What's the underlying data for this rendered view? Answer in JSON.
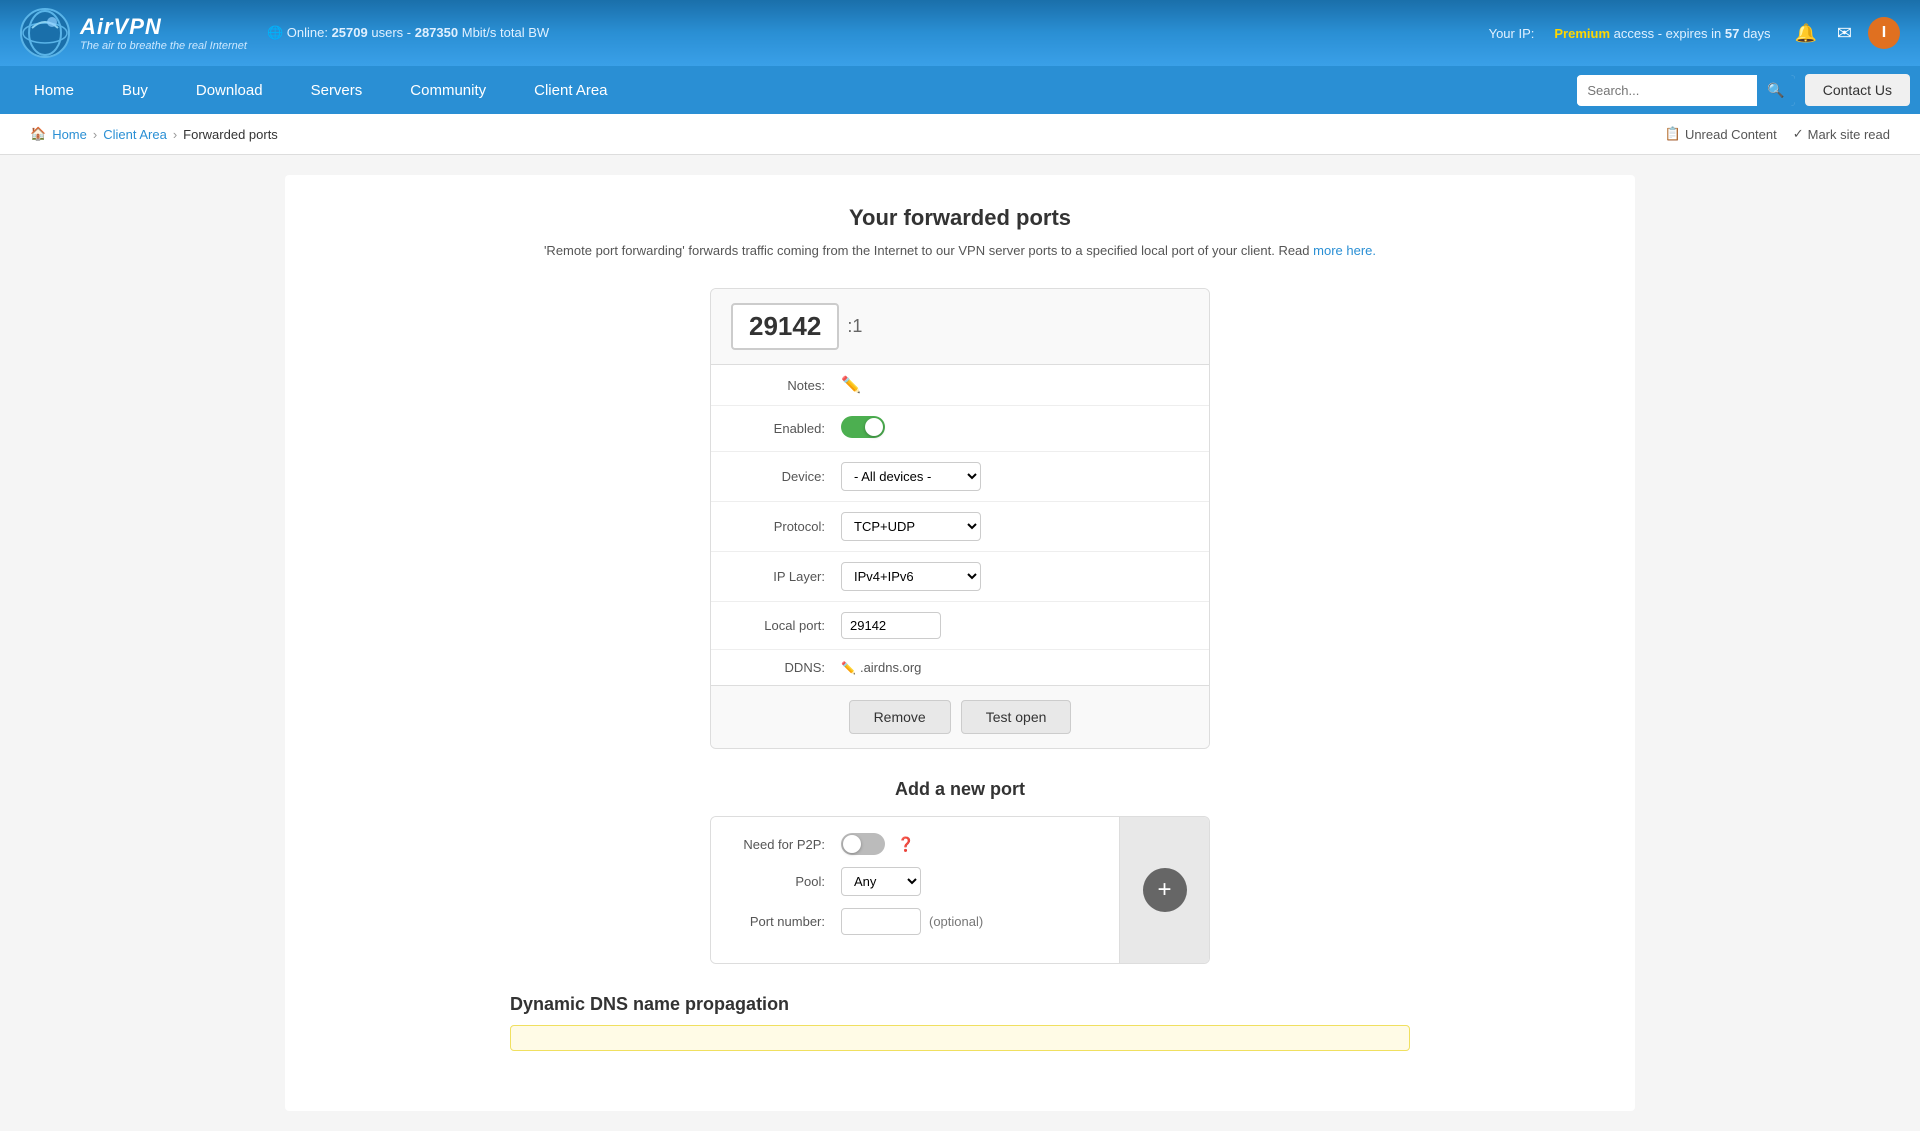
{
  "header": {
    "logo_title": "AirVPN",
    "logo_subtitle": "The air to breathe the real Internet",
    "stats_online_label": "Online:",
    "stats_users": "25709",
    "stats_users_suffix": "users -",
    "stats_bandwidth": "287350",
    "stats_bandwidth_suffix": "Mbit/s total BW",
    "ip_label": "Your IP:",
    "premium_label": "Premium",
    "premium_suffix": "access - expires in",
    "premium_days": "57",
    "premium_days_suffix": "days",
    "user_initial": "I"
  },
  "nav": {
    "links": [
      {
        "label": "Home",
        "key": "home"
      },
      {
        "label": "Buy",
        "key": "buy"
      },
      {
        "label": "Download",
        "key": "download"
      },
      {
        "label": "Servers",
        "key": "servers"
      },
      {
        "label": "Community",
        "key": "community"
      },
      {
        "label": "Client Area",
        "key": "client-area"
      }
    ],
    "search_placeholder": "Search...",
    "contact_label": "Contact Us"
  },
  "breadcrumb": {
    "home": "Home",
    "client_area": "Client Area",
    "current": "Forwarded ports",
    "unread_content": "Unread Content",
    "mark_site_read": "Mark site read"
  },
  "page": {
    "title": "Your forwarded ports",
    "description": "'Remote port forwarding' forwards traffic coming from the Internet to our VPN server ports to a specified local port of your client. Read",
    "more_here_link": "more here.",
    "port_number": "29142",
    "port_suffix": ":1",
    "notes_label": "Notes:",
    "enabled_label": "Enabled:",
    "device_label": "Device:",
    "device_value": "- All devices -",
    "protocol_label": "Protocol:",
    "protocol_value": "TCP+UDP",
    "iplayer_label": "IP Layer:",
    "iplayer_value": "IPv4+IPv6",
    "local_port_label": "Local port:",
    "local_port_value": "29142",
    "ddns_label": "DDNS:",
    "ddns_value": ".airdns.org",
    "remove_btn": "Remove",
    "test_btn": "Test open",
    "add_port_title": "Add a new port",
    "p2p_label": "Need for P2P:",
    "pool_label": "Pool:",
    "pool_value": "Any",
    "port_number_label": "Port number:",
    "port_optional": "(optional)",
    "dns_title": "Dynamic DNS name propagation"
  }
}
